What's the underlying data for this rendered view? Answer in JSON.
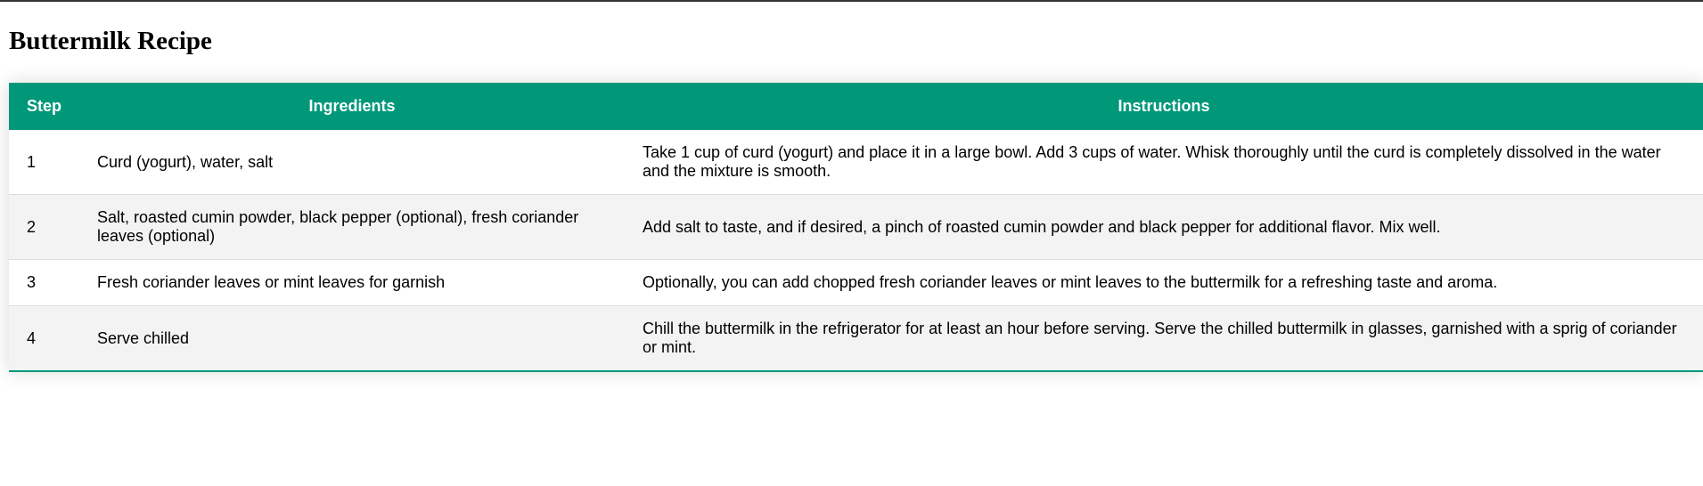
{
  "page": {
    "title": "Buttermilk Recipe"
  },
  "colors": {
    "header_bg": "#009879",
    "header_text": "#ffffff",
    "row_alt_bg": "#f3f3f3",
    "accent_border": "#009879"
  },
  "table": {
    "headers": {
      "step": "Step",
      "ingredients": "Ingredients",
      "instructions": "Instructions"
    },
    "rows": [
      {
        "step": "1",
        "ingredients": "Curd (yogurt), water, salt",
        "instructions": "Take 1 cup of curd (yogurt) and place it in a large bowl. Add 3 cups of water. Whisk thoroughly until the curd is completely dissolved in the water and the mixture is smooth."
      },
      {
        "step": "2",
        "ingredients": "Salt, roasted cumin powder, black pepper (optional), fresh coriander leaves (optional)",
        "instructions": "Add salt to taste, and if desired, a pinch of roasted cumin powder and black pepper for additional flavor. Mix well."
      },
      {
        "step": "3",
        "ingredients": "Fresh coriander leaves or mint leaves for garnish",
        "instructions": "Optionally, you can add chopped fresh coriander leaves or mint leaves to the buttermilk for a refreshing taste and aroma."
      },
      {
        "step": "4",
        "ingredients": "Serve chilled",
        "instructions": "Chill the buttermilk in the refrigerator for at least an hour before serving. Serve the chilled buttermilk in glasses, garnished with a sprig of coriander or mint."
      }
    ]
  }
}
